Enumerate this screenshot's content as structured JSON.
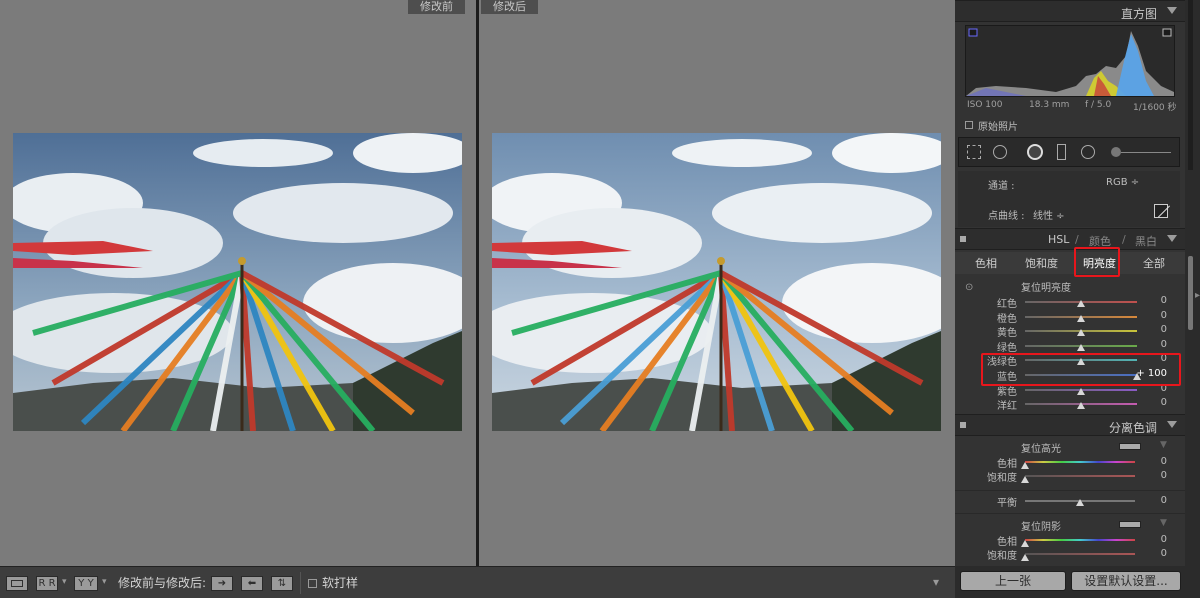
{
  "labels": {
    "before": "修改前",
    "after": "修改后"
  },
  "toolbar": {
    "view_rr": "R R",
    "view_yy": "Y Y",
    "compare_label": "修改前与修改后:",
    "soft_proof_label": "软打样"
  },
  "histogram": {
    "title": "直方图",
    "iso": "ISO 100",
    "focal": "18.3 mm",
    "aperture": "f / 5.0",
    "shutter": "1/1600 秒",
    "original_photo": "原始照片"
  },
  "tone_curve": {
    "channel_label": "通道 :",
    "channel_value": "RGB ÷",
    "curve_label": "点曲线 :",
    "curve_value": "线性 ÷"
  },
  "hsl": {
    "title_hsl": "HSL",
    "title_sep1": "/",
    "title_color": "颜色",
    "title_sep2": "/",
    "title_bw": "黑白",
    "tabs": [
      "色相",
      "饱和度",
      "明亮度",
      "全部"
    ],
    "section": "复位明亮度",
    "rows": [
      {
        "label": "红色",
        "value": "0",
        "amount": 0,
        "track": "#c0504d"
      },
      {
        "label": "橙色",
        "value": "0",
        "amount": 0,
        "track": "#d7883b"
      },
      {
        "label": "黄色",
        "value": "0",
        "amount": 0,
        "track": "#c9c43a"
      },
      {
        "label": "绿色",
        "value": "0",
        "amount": 0,
        "track": "#6aaa4a"
      },
      {
        "label": "浅绿色",
        "value": "0",
        "amount": 0,
        "track": "#52b3b3"
      },
      {
        "label": "蓝色",
        "value": "+ 100",
        "amount": 100,
        "track": "#4a6fc4"
      },
      {
        "label": "紫色",
        "value": "0",
        "amount": 0,
        "track": "#8a5bc4"
      },
      {
        "label": "洋红",
        "value": "0",
        "amount": 0,
        "track": "#c45bb0"
      }
    ]
  },
  "split": {
    "title": "分离色调",
    "highlight_reset": "复位高光",
    "hue": "色相",
    "saturation": "饱和度",
    "balance": "平衡",
    "shadow_reset": "复位阴影",
    "hue2": "色相",
    "saturation2": "饱和度",
    "zero": "0"
  },
  "buttons": {
    "prev": "上一张",
    "defaults": "设置默认设置..."
  },
  "colors": {
    "highlight_box": "#e8161c",
    "panel_bg": "#333333",
    "canvas_bg": "#7b7b7b"
  }
}
